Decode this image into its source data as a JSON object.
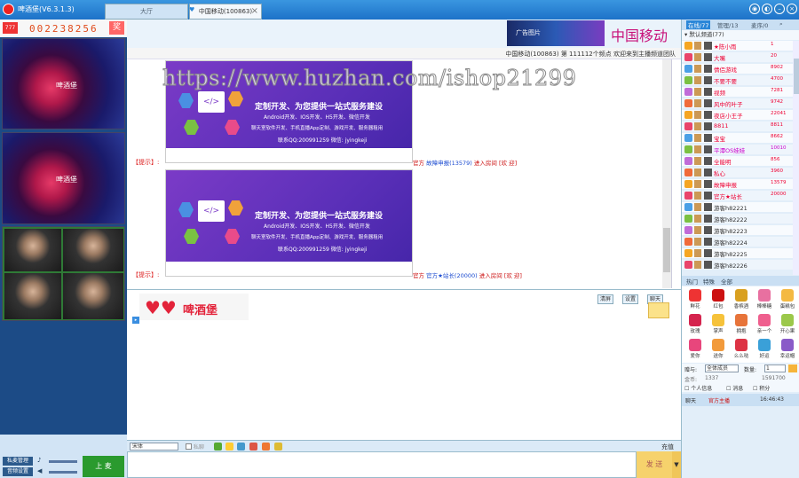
{
  "window": {
    "title": "啤酒堡(V6.3.1.3)",
    "logo": "heart-logo-icon"
  },
  "tabs": [
    {
      "label": "大厅"
    },
    {
      "label": "中国移动(100863)"
    }
  ],
  "window_buttons": [
    "settings-icon",
    "skin-icon",
    "minimize-icon",
    "close-icon"
  ],
  "counter": {
    "badge": "777",
    "value": "002238256",
    "button": "奖"
  },
  "videos": [
    {
      "label": "啤酒堡"
    },
    {
      "label": "啤酒堡"
    },
    {
      "label": ""
    }
  ],
  "left_controls": {
    "mic_manage": "私麦管理",
    "audio_settings": "音频设置",
    "mic_button": "上 麦"
  },
  "banner": {
    "image_text": "广告图片",
    "text": "中国移动通"
  },
  "notice": "中国移动(100863) 第 111112个频点 欢迎来到主播频道团队",
  "watermark": "https://www.huzhan.com/ishop21299",
  "ads": [
    {
      "title": "定制开发、为您提供一站式服务建设",
      "subtitle": "Android开发、IOS开发、H5开发、微信开发",
      "line2": "聊天室软件开发、手机直播App定制、游戏开发、服务器租用",
      "contact": "联系QQ:200991259   微信: jyingkeji"
    },
    {
      "title": "定制开发、为您提供一站式服务建设",
      "subtitle": "Android开发、IOS开发、H5开发、微信开发",
      "line2": "聊天室软件开发、手机直播App定制、游戏开发、服务器租用",
      "contact": "联系QQ:200991259   微信: jyingkeji"
    }
  ],
  "messages": [
    {
      "tip": "【提示】:",
      "prefix": "官方",
      "user": "故障申报(13579)",
      "action": "进入房间",
      "welcome": "[欢 迎]"
    },
    {
      "tip": "【提示】:",
      "prefix": "官方",
      "user": "官方★站长(20000)",
      "action": "进入房间",
      "welcome": "[欢 迎]"
    }
  ],
  "private_chat": {
    "logo_text": "啤酒堡",
    "buttons": [
      "清屏",
      "设置",
      "聊天"
    ]
  },
  "input_toolbar": {
    "font_select": "宋体",
    "checkbox_label": "私聊",
    "recharge": "充值"
  },
  "send": {
    "label": "发 送",
    "arrow": "▼"
  },
  "right_tabs": [
    "在线/77",
    "管理/13",
    "麦序/0"
  ],
  "user_group": "默认频道(77)",
  "users": [
    {
      "name": "★陈小雨",
      "id": "1",
      "color": "#e03"
    },
    {
      "name": "大嘴",
      "id": "20",
      "color": "#e03"
    },
    {
      "name": "情侣游戏",
      "id": "8902",
      "color": "#e03"
    },
    {
      "name": "不要不要",
      "id": "4700",
      "color": "#e03"
    },
    {
      "name": "视频",
      "id": "7281",
      "color": "#e03"
    },
    {
      "name": "风中的叶子",
      "id": "9742",
      "color": "#e03"
    },
    {
      "name": "夜店小王子",
      "id": "22041",
      "color": "#e03"
    },
    {
      "name": "8811",
      "id": "8811",
      "color": "#e03"
    },
    {
      "name": "宝宝",
      "id": "8662",
      "color": "#e03"
    },
    {
      "name": "平潭OS娃娃",
      "id": "10010",
      "color": "#c0c"
    },
    {
      "name": "全能明",
      "id": "856",
      "color": "#e03"
    },
    {
      "name": "私心",
      "id": "3960",
      "color": "#e03"
    },
    {
      "name": "故障申报",
      "id": "13579",
      "color": "#e03"
    },
    {
      "name": "官方★站长",
      "id": "20000",
      "color": "#e03"
    },
    {
      "name": "游客h82221",
      "id": "",
      "color": "#333"
    },
    {
      "name": "游客h82222",
      "id": "",
      "color": "#333"
    },
    {
      "name": "游客h82223",
      "id": "",
      "color": "#333"
    },
    {
      "name": "游客h82224",
      "id": "",
      "color": "#333"
    },
    {
      "name": "游客h82225",
      "id": "",
      "color": "#333"
    },
    {
      "name": "游客h82226",
      "id": "",
      "color": "#333"
    }
  ],
  "gift_tabs": [
    "热门",
    "特殊",
    "全部"
  ],
  "gifts": [
    "鲜花",
    "红包",
    "香槟酒",
    "棒棒糖",
    "蛋糕包",
    "玫瑰",
    "掌声",
    "拥抱",
    "亲一个",
    "开心果",
    "爱你",
    "送你",
    "么么哒",
    "好运",
    "幸运帽"
  ],
  "gift_form": {
    "to_label": "赠与:",
    "to_value": "全体成员",
    "count_label": "数量:",
    "count_value": "1",
    "money_label": "金币:",
    "money_value": "1337",
    "points_label": "1591700"
  },
  "gift_links": [
    "个人信息",
    "消息",
    "积分"
  ],
  "footer": {
    "tab": "聊天",
    "link": "官方主播",
    "time": "16:46:43"
  }
}
